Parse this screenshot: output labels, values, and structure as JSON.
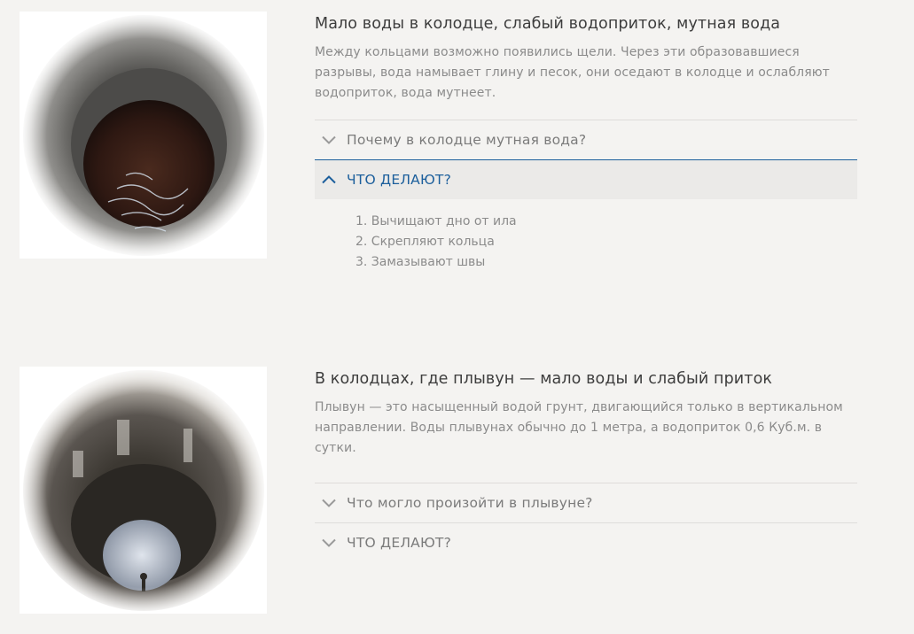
{
  "sections": [
    {
      "title": "Мало воды в колодце, слабый водоприток, мутная вода",
      "description": "Между кольцами возможно появились щели. Через эти образовавшиеся разрывы, вода намывает глину и песок, они оседают в колодце и ослабляют водоприток, вода мутнеет.",
      "accordion": [
        {
          "label": "Почему в колодце мутная вода?",
          "expanded": false,
          "icon": "chevron-down-icon"
        },
        {
          "label": "ЧТО ДЕЛАЮТ?",
          "expanded": true,
          "icon": "chevron-up-icon",
          "items": [
            "1. Вычищают дно от ила",
            "2. Скрепляют кольца",
            "3. Замазывают швы"
          ]
        }
      ]
    },
    {
      "title": "В колодцах, где плывун — мало воды и слабый приток",
      "description": "Плывун — это насыщенный водой грунт, двигающийся только в вертикальном направлении. Воды плывунах обычно до 1 метра, а водоприток 0,6 Куб.м. в сутки.",
      "accordion": [
        {
          "label": "Что могло произойти в плывуне?",
          "expanded": false,
          "icon": "chevron-down-icon"
        },
        {
          "label": "ЧТО ДЕЛАЮТ?",
          "expanded": false,
          "icon": "chevron-down-icon"
        }
      ]
    }
  ],
  "colors": {
    "background": "#f4f3f1",
    "title": "#3d3d3d",
    "text": "#8b8b8b",
    "accent": "#1c5f9c",
    "active_header_bg": "#ebeae8"
  }
}
